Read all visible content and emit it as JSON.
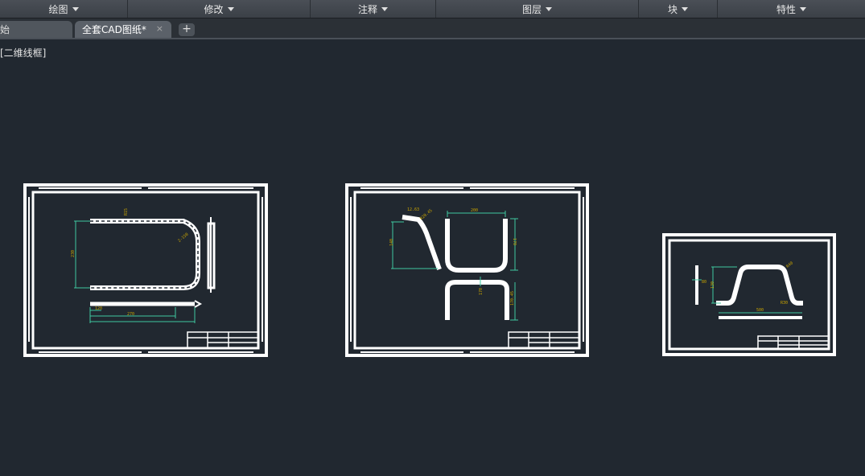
{
  "ribbon": {
    "panels": [
      {
        "label": "绘图"
      },
      {
        "label": "修改"
      },
      {
        "label": "注释"
      },
      {
        "label": "图层"
      },
      {
        "label": "块"
      },
      {
        "label": "特性"
      }
    ]
  },
  "tabs": {
    "inactive_label": "始",
    "active_label": "全套CAD图纸*",
    "close_glyph": "×",
    "add_glyph": "+"
  },
  "viewport": {
    "label": "[二维线框]"
  },
  "drawings": {
    "sheet1": {
      "dims": [
        "R15",
        "2-150",
        "230",
        "120",
        "270"
      ]
    },
    "sheet2": {
      "dims": [
        "12.63",
        "R20.45",
        "200",
        "140",
        "170",
        "170",
        "170.45"
      ]
    },
    "sheet3": {
      "dims": [
        "80",
        "R40",
        "130",
        "R30",
        "500"
      ]
    }
  },
  "colors": {
    "background": "#212830",
    "sheet": "#ffffff",
    "dimension": "#c9a400",
    "extension": "#3ec9a0"
  }
}
